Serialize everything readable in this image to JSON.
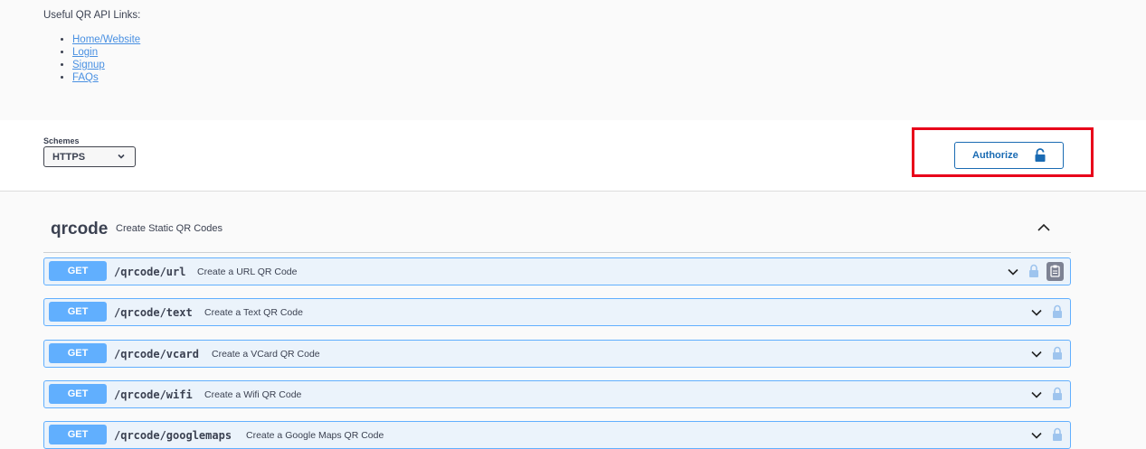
{
  "intro": "Useful QR API Links:",
  "links": [
    {
      "label": "Home/Website"
    },
    {
      "label": "Login"
    },
    {
      "label": "Signup"
    },
    {
      "label": "FAQs"
    }
  ],
  "schemes": {
    "label": "Schemes",
    "selected": "HTTPS"
  },
  "authorize": {
    "label": "Authorize"
  },
  "tag": {
    "name": "qrcode",
    "description": "Create Static QR Codes"
  },
  "operations": [
    {
      "method": "GET",
      "path": "/qrcode/url",
      "summary": "Create a URL QR Code"
    },
    {
      "method": "GET",
      "path": "/qrcode/text",
      "summary": "Create a Text QR Code"
    },
    {
      "method": "GET",
      "path": "/qrcode/vcard",
      "summary": "Create a VCard QR Code"
    },
    {
      "method": "GET",
      "path": "/qrcode/wifi",
      "summary": "Create a Wifi QR Code"
    },
    {
      "method": "GET",
      "path": "/qrcode/googlemaps",
      "summary": "Create a Google Maps QR Code"
    }
  ],
  "colors": {
    "get_method": "#61affe",
    "link": "#4990e2",
    "highlight": "#e8001a",
    "authorize": "#1a6bb3"
  }
}
